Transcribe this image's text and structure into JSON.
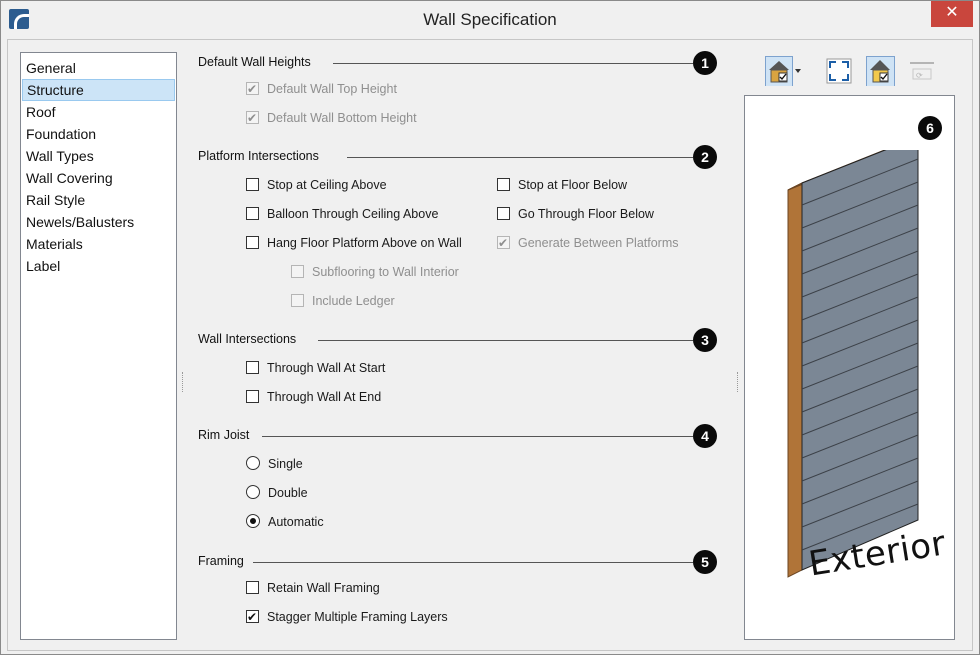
{
  "window": {
    "title": "Wall Specification",
    "close_glyph": "✕"
  },
  "nav": {
    "items": [
      {
        "label": "General",
        "selected": false
      },
      {
        "label": "Structure",
        "selected": true
      },
      {
        "label": "Roof",
        "selected": false
      },
      {
        "label": "Foundation",
        "selected": false
      },
      {
        "label": "Wall Types",
        "selected": false
      },
      {
        "label": "Wall Covering",
        "selected": false
      },
      {
        "label": "Rail Style",
        "selected": false
      },
      {
        "label": "Newels/Balusters",
        "selected": false
      },
      {
        "label": "Materials",
        "selected": false
      },
      {
        "label": "Label",
        "selected": false
      }
    ]
  },
  "sections": {
    "default_wall_heights": {
      "title": "Default Wall Heights",
      "badge": "1",
      "top_height": {
        "label": "Default Wall Top Height",
        "checked": true,
        "enabled": false
      },
      "bottom_height": {
        "label": "Default Wall Bottom Height",
        "checked": true,
        "enabled": false
      }
    },
    "platform_intersections": {
      "title": "Platform Intersections",
      "badge": "2",
      "stop_at_ceiling": {
        "label": "Stop at Ceiling Above",
        "checked": false
      },
      "balloon_through": {
        "label": "Balloon Through Ceiling Above",
        "checked": false
      },
      "hang_floor": {
        "label": "Hang Floor Platform Above on Wall",
        "checked": false
      },
      "subflooring": {
        "label": "Subflooring to Wall Interior",
        "checked": false,
        "enabled": false
      },
      "include_ledger": {
        "label": "Include Ledger",
        "checked": false,
        "enabled": false
      },
      "stop_at_floor": {
        "label": "Stop at Floor Below",
        "checked": false
      },
      "go_through_floor": {
        "label": "Go Through Floor Below",
        "checked": false
      },
      "generate_between": {
        "label": "Generate Between Platforms",
        "checked": true,
        "enabled": false
      }
    },
    "wall_intersections": {
      "title": "Wall Intersections",
      "badge": "3",
      "at_start": {
        "label": "Through Wall At Start",
        "checked": false
      },
      "at_end": {
        "label": "Through Wall At End",
        "checked": false
      }
    },
    "rim_joist": {
      "title": "Rim Joist",
      "badge": "4",
      "options": [
        "Single",
        "Double",
        "Automatic"
      ],
      "selected": "Automatic"
    },
    "framing": {
      "title": "Framing",
      "badge": "5",
      "retain": {
        "label": "Retain Wall Framing",
        "checked": false
      },
      "stagger": {
        "label": "Stagger Multiple Framing Layers",
        "checked": true
      }
    }
  },
  "preview": {
    "badge": "6",
    "caption": "Exterior",
    "wall_face_color": "#7b8795",
    "wall_edge_color": "#c28a4e"
  },
  "toolbar": {
    "icons": [
      "house-view-icon",
      "dropdown-arrow-icon",
      "fill-window-icon",
      "material-view-icon",
      "rotate-icon"
    ]
  }
}
